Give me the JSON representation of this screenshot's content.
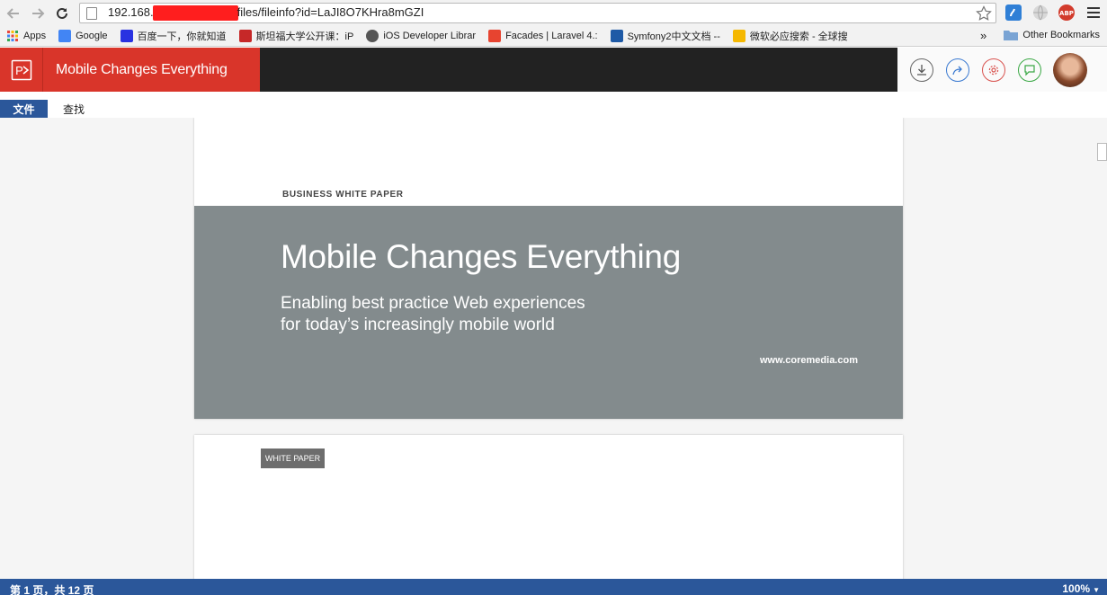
{
  "browser": {
    "url_prefix": "192.168.",
    "url_suffix": "files/fileinfo?id=LaJI8O7KHra8mGZI",
    "bookmarks": [
      {
        "label": "Apps",
        "color": "#e8453c"
      },
      {
        "label": "Google",
        "color": "#4285f4"
      },
      {
        "label": "百度一下，你就知道",
        "color": "#2932e1"
      },
      {
        "label": "斯坦福大学公开课：iP",
        "color": "#c62828"
      },
      {
        "label": "iOS Developer Librar",
        "color": "#555555"
      },
      {
        "label": "Facades | Laravel 4.:",
        "color": "#e74430"
      },
      {
        "label": "Symfony2中文文档 --",
        "color": "#1e5aa6"
      },
      {
        "label": "微软必应搜索 - 全球搜",
        "color": "#f5b800"
      }
    ],
    "bookmarks_more": "»",
    "other_bookmarks": "Other Bookmarks"
  },
  "app": {
    "title": "Mobile Changes Everything",
    "brand_color": "#d9352a"
  },
  "ribbon": {
    "tabs": [
      "文件",
      "查找"
    ]
  },
  "document": {
    "page1": {
      "kicker": "BUSINESS WHITE PAPER",
      "title": "Mobile Changes Everything",
      "subtitle_line1": "Enabling best practice Web experiences",
      "subtitle_line2": "for today’s increasingly mobile world",
      "url": "www.coremedia.com"
    },
    "page2": {
      "tag": "WHITE PAPER"
    }
  },
  "status": {
    "page_info": "第 1 页，共 12 页",
    "zoom": "100%"
  }
}
